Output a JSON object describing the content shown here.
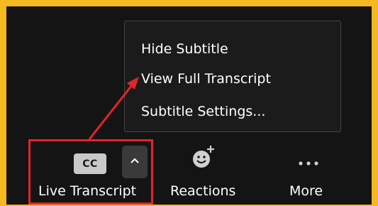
{
  "menu": {
    "items": [
      {
        "label": "Hide Subtitle"
      },
      {
        "label": "View Full Transcript"
      },
      {
        "label": "Subtitle Settings..."
      }
    ]
  },
  "toolbar": {
    "live_transcript": {
      "label": "Live Transcript",
      "icon_text": "CC",
      "icon": "cc-icon"
    },
    "options_caret": {
      "icon": "chevron-up-icon"
    },
    "reactions": {
      "label": "Reactions",
      "icon": "emoji-add-icon"
    },
    "more": {
      "label": "More",
      "icon": "ellipsis-icon"
    }
  },
  "annotation": {
    "highlight_color": "#e3242b",
    "arrow_color": "#e3242b"
  },
  "colors": {
    "border_frame": "#f6b81f",
    "background": "#141414",
    "menu_background": "#1b1b1b"
  }
}
